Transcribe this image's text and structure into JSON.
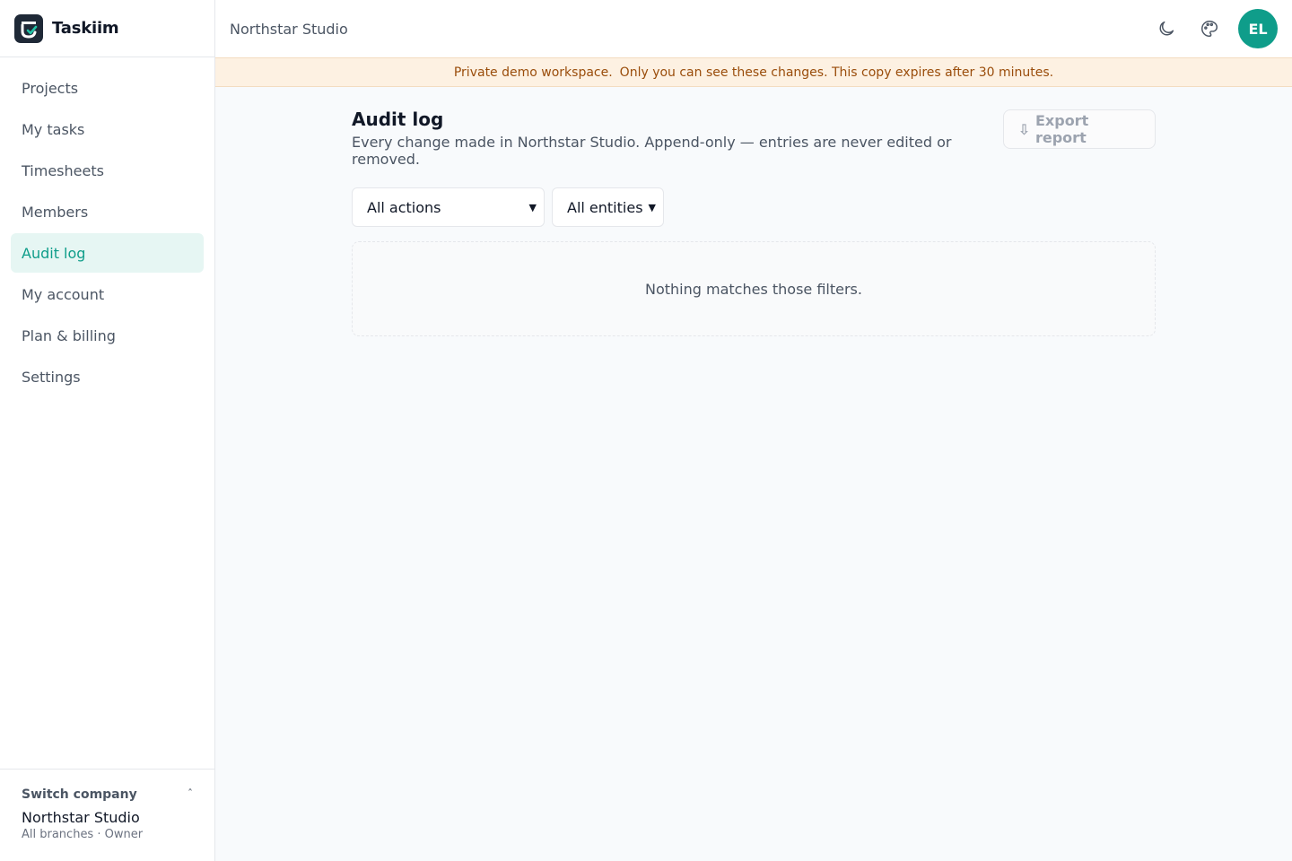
{
  "brand": {
    "name": "Taskiim"
  },
  "nav": [
    {
      "id": "projects",
      "label": "Projects"
    },
    {
      "id": "my-tasks",
      "label": "My tasks"
    },
    {
      "id": "timesheets",
      "label": "Timesheets"
    },
    {
      "id": "members",
      "label": "Members"
    },
    {
      "id": "audit-log",
      "label": "Audit log",
      "active": true
    },
    {
      "id": "my-account",
      "label": "My account"
    },
    {
      "id": "plan-billing",
      "label": "Plan & billing"
    },
    {
      "id": "settings",
      "label": "Settings"
    }
  ],
  "switcher": {
    "label": "Switch company",
    "company": "Northstar Studio",
    "meta": "All branches · Owner",
    "chevron": "ˆ"
  },
  "topbar": {
    "workspace": "Northstar Studio",
    "avatar_initials": "EL",
    "icons": [
      "moon-icon",
      "palette-icon"
    ]
  },
  "banner": {
    "part1": "Private demo workspace.",
    "part2": "Only you can see these changes. This copy expires after 30 minutes."
  },
  "page": {
    "title": "Audit log",
    "description": "Every change made in Northstar Studio. Append-only — entries are never edited or removed.",
    "export_icon": "⇩",
    "export_label": "Export report"
  },
  "filters": {
    "actions": "All actions",
    "entities": "All entities"
  },
  "empty_state": "Nothing matches those filters.",
  "colors": {
    "accent": "#0f9d8a",
    "active_bg": "#e6f6f3",
    "banner_bg": "#fdf1e2",
    "banner_text": "#9a4d0b"
  }
}
